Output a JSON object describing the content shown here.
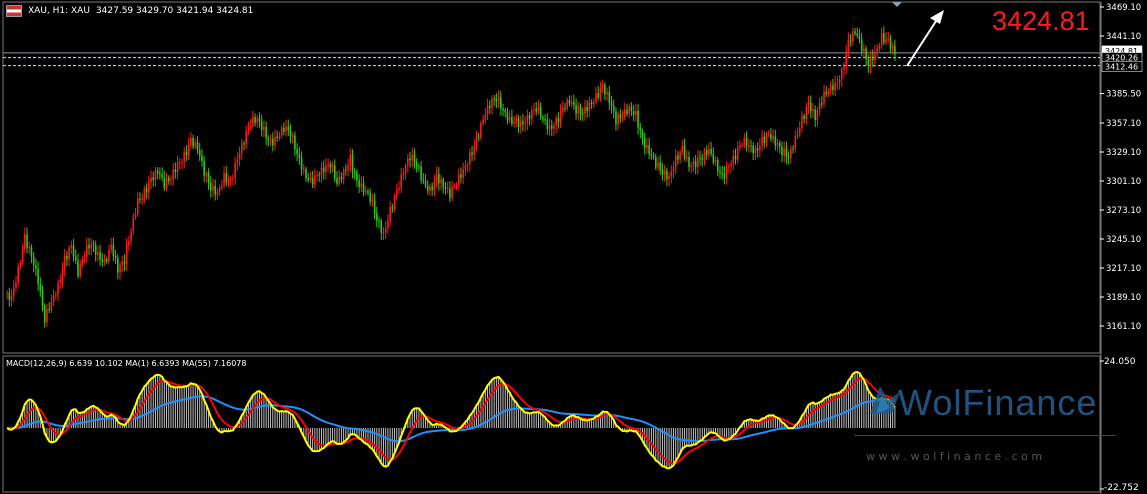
{
  "header": {
    "symbol_info": "XAU, H1:  XAU",
    "ohlc": "3427.59 3429.70 3421.94 3424.81",
    "flag_icon": "flag-icon"
  },
  "last_price_big": "3424.81",
  "price_axis": {
    "ticks": [
      "3469.10",
      "3441.10",
      "3385.50",
      "3357.10",
      "3329.10",
      "3301.10",
      "3273.10",
      "3245.10",
      "3217.10",
      "3189.10",
      "3161.10"
    ],
    "tick_values": [
      3469.1,
      3441.1,
      3385.5,
      3357.1,
      3329.1,
      3301.1,
      3273.1,
      3245.1,
      3217.1,
      3189.1,
      3161.1
    ],
    "badges": [
      {
        "label": "3424.81",
        "value": 3424.81,
        "color": "#ffffff",
        "text": "#000000"
      },
      {
        "label": "3420.26",
        "value": 3420.26,
        "color": "#000000",
        "text": "#ffffff"
      },
      {
        "label": "3412.46",
        "value": 3412.46,
        "color": "#000000",
        "text": "#ffffff"
      }
    ],
    "dashed_levels": [
      3420.26,
      3412.46
    ],
    "solid_level": 3424.81
  },
  "macd_panel": {
    "label": "MACD(12,26,9) 6.639 10.102 MA(1) 6.6393 MA(55) 7.16078",
    "top_tick": "24.050",
    "bottom_tick": "-22.752",
    "range": [
      -22.752,
      24.05
    ]
  },
  "watermark": {
    "brand": "WolFinance",
    "url": "w w w . w o l f i n a n c e . c o m"
  },
  "colors": {
    "bull": "#ff1a1a",
    "bear": "#2ecc14",
    "macd_signal": "#ffff00",
    "macd_line": "#ff0000",
    "ma55": "#1e90ff",
    "hist": "#cfcfcf",
    "big_price": "#ff1a1a",
    "arrow": "#ffffff"
  },
  "chart_data": {
    "type": "candlestick",
    "symbol": "XAU",
    "timeframe": "H1",
    "ylim": [
      3140,
      3475
    ],
    "closes": [
      3190,
      3215,
      3246,
      3228,
      3205,
      3168,
      3185,
      3200,
      3225,
      3238,
      3212,
      3232,
      3242,
      3230,
      3222,
      3238,
      3215,
      3225,
      3255,
      3282,
      3290,
      3302,
      3310,
      3298,
      3305,
      3318,
      3325,
      3340,
      3332,
      3310,
      3295,
      3290,
      3305,
      3300,
      3322,
      3340,
      3358,
      3362,
      3350,
      3338,
      3342,
      3352,
      3348,
      3328,
      3310,
      3300,
      3306,
      3312,
      3318,
      3300,
      3310,
      3322,
      3300,
      3292,
      3285,
      3265,
      3250,
      3272,
      3290,
      3310,
      3325,
      3318,
      3300,
      3292,
      3305,
      3296,
      3288,
      3300,
      3312,
      3325,
      3340,
      3360,
      3375,
      3382,
      3370,
      3360,
      3358,
      3355,
      3364,
      3372,
      3362,
      3352,
      3358,
      3370,
      3378,
      3370,
      3368,
      3375,
      3382,
      3392,
      3378,
      3360,
      3365,
      3372,
      3365,
      3340,
      3328,
      3318,
      3310,
      3305,
      3322,
      3332,
      3315,
      3318,
      3325,
      3332,
      3318,
      3305,
      3315,
      3325,
      3340,
      3336,
      3330,
      3340,
      3345,
      3338,
      3330,
      3325,
      3342,
      3360,
      3375,
      3362,
      3380,
      3390,
      3394,
      3405,
      3435,
      3445,
      3430,
      3415,
      3425,
      3440,
      3436,
      3424
    ]
  }
}
